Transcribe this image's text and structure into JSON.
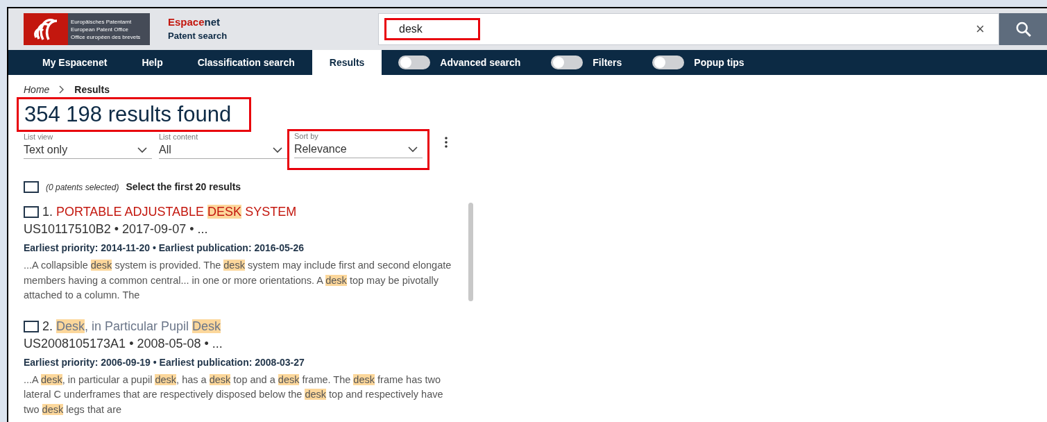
{
  "header": {
    "logo_lines": [
      "Europäisches Patentamt",
      "European Patent Office",
      "Office européen des brevets"
    ],
    "brand": [
      {
        "text": "Espace",
        "accent": true
      },
      {
        "text": "net",
        "accent": false
      }
    ],
    "subtitle": "Patent search",
    "search": {
      "value": "desk",
      "annotated": true,
      "clear": "×"
    }
  },
  "nav": {
    "tabs": [
      {
        "label": "My Espacenet",
        "selected": false
      },
      {
        "label": "Help",
        "selected": false
      },
      {
        "label": "Classification search",
        "selected": false
      },
      {
        "label": "Results",
        "selected": true
      }
    ],
    "toggles": [
      {
        "label": "Advanced search",
        "on": false
      },
      {
        "label": "Filters",
        "on": false
      },
      {
        "label": "Popup tips",
        "on": false
      }
    ]
  },
  "breadcrumb": [
    {
      "label": "Home",
      "current": false
    },
    {
      "label": "Results",
      "current": true
    }
  ],
  "results_count": {
    "text": "354 198 results found",
    "annotated": true
  },
  "dropdowns": [
    {
      "label": "List view",
      "value": "Text only",
      "annotated": false
    },
    {
      "label": "List content",
      "value": "All",
      "annotated": false
    },
    {
      "label": "Sort by",
      "value": "Relevance",
      "annotated": true
    }
  ],
  "selection": {
    "checked": false,
    "count": "(0 patents selected)",
    "action": "Select the first 20 results"
  },
  "results": [
    {
      "number": "1.",
      "checked": false,
      "visited": false,
      "title": [
        {
          "text": "PORTABLE ADJUSTABLE ",
          "highlight": false
        },
        {
          "text": "DESK",
          "highlight": true
        },
        {
          "text": " SYSTEM",
          "highlight": false
        }
      ],
      "id_line": "US10117510B2 • 2017-09-07 • ...",
      "dates": "Earliest priority: 2014-11-20 • Earliest publication: 2016-05-26",
      "abstract": [
        {
          "text": "...A collapsible ",
          "highlight": false
        },
        {
          "text": "desk",
          "highlight": true
        },
        {
          "text": " system is provided. The ",
          "highlight": false
        },
        {
          "text": "desk",
          "highlight": true
        },
        {
          "text": " system may include first and second elongate members having a common central... in one or more orientations. A ",
          "highlight": false
        },
        {
          "text": "desk",
          "highlight": true
        },
        {
          "text": " top may be pivotally attached to a column. The",
          "highlight": false
        }
      ]
    },
    {
      "number": "2.",
      "checked": false,
      "visited": true,
      "title": [
        {
          "text": "Desk",
          "highlight": true
        },
        {
          "text": ", in Particular Pupil ",
          "highlight": false
        },
        {
          "text": "Desk",
          "highlight": true
        }
      ],
      "id_line": "US2008105173A1 • 2008-05-08 • ...",
      "dates": "Earliest priority: 2006-09-19 • Earliest publication: 2008-03-27",
      "abstract": [
        {
          "text": "...A ",
          "highlight": false
        },
        {
          "text": "desk",
          "highlight": true
        },
        {
          "text": ", in particular a pupil ",
          "highlight": false
        },
        {
          "text": "desk",
          "highlight": true
        },
        {
          "text": ", has a ",
          "highlight": false
        },
        {
          "text": "desk",
          "highlight": true
        },
        {
          "text": " top and a ",
          "highlight": false
        },
        {
          "text": "desk",
          "highlight": true
        },
        {
          "text": " frame. The ",
          "highlight": false
        },
        {
          "text": "desk",
          "highlight": true
        },
        {
          "text": " frame has two lateral C underframes that are respectively disposed below the ",
          "highlight": false
        },
        {
          "text": "desk",
          "highlight": true
        },
        {
          "text": " top and respectively have two ",
          "highlight": false
        },
        {
          "text": "desk",
          "highlight": true
        },
        {
          "text": " legs that are",
          "highlight": false
        }
      ]
    }
  ]
}
